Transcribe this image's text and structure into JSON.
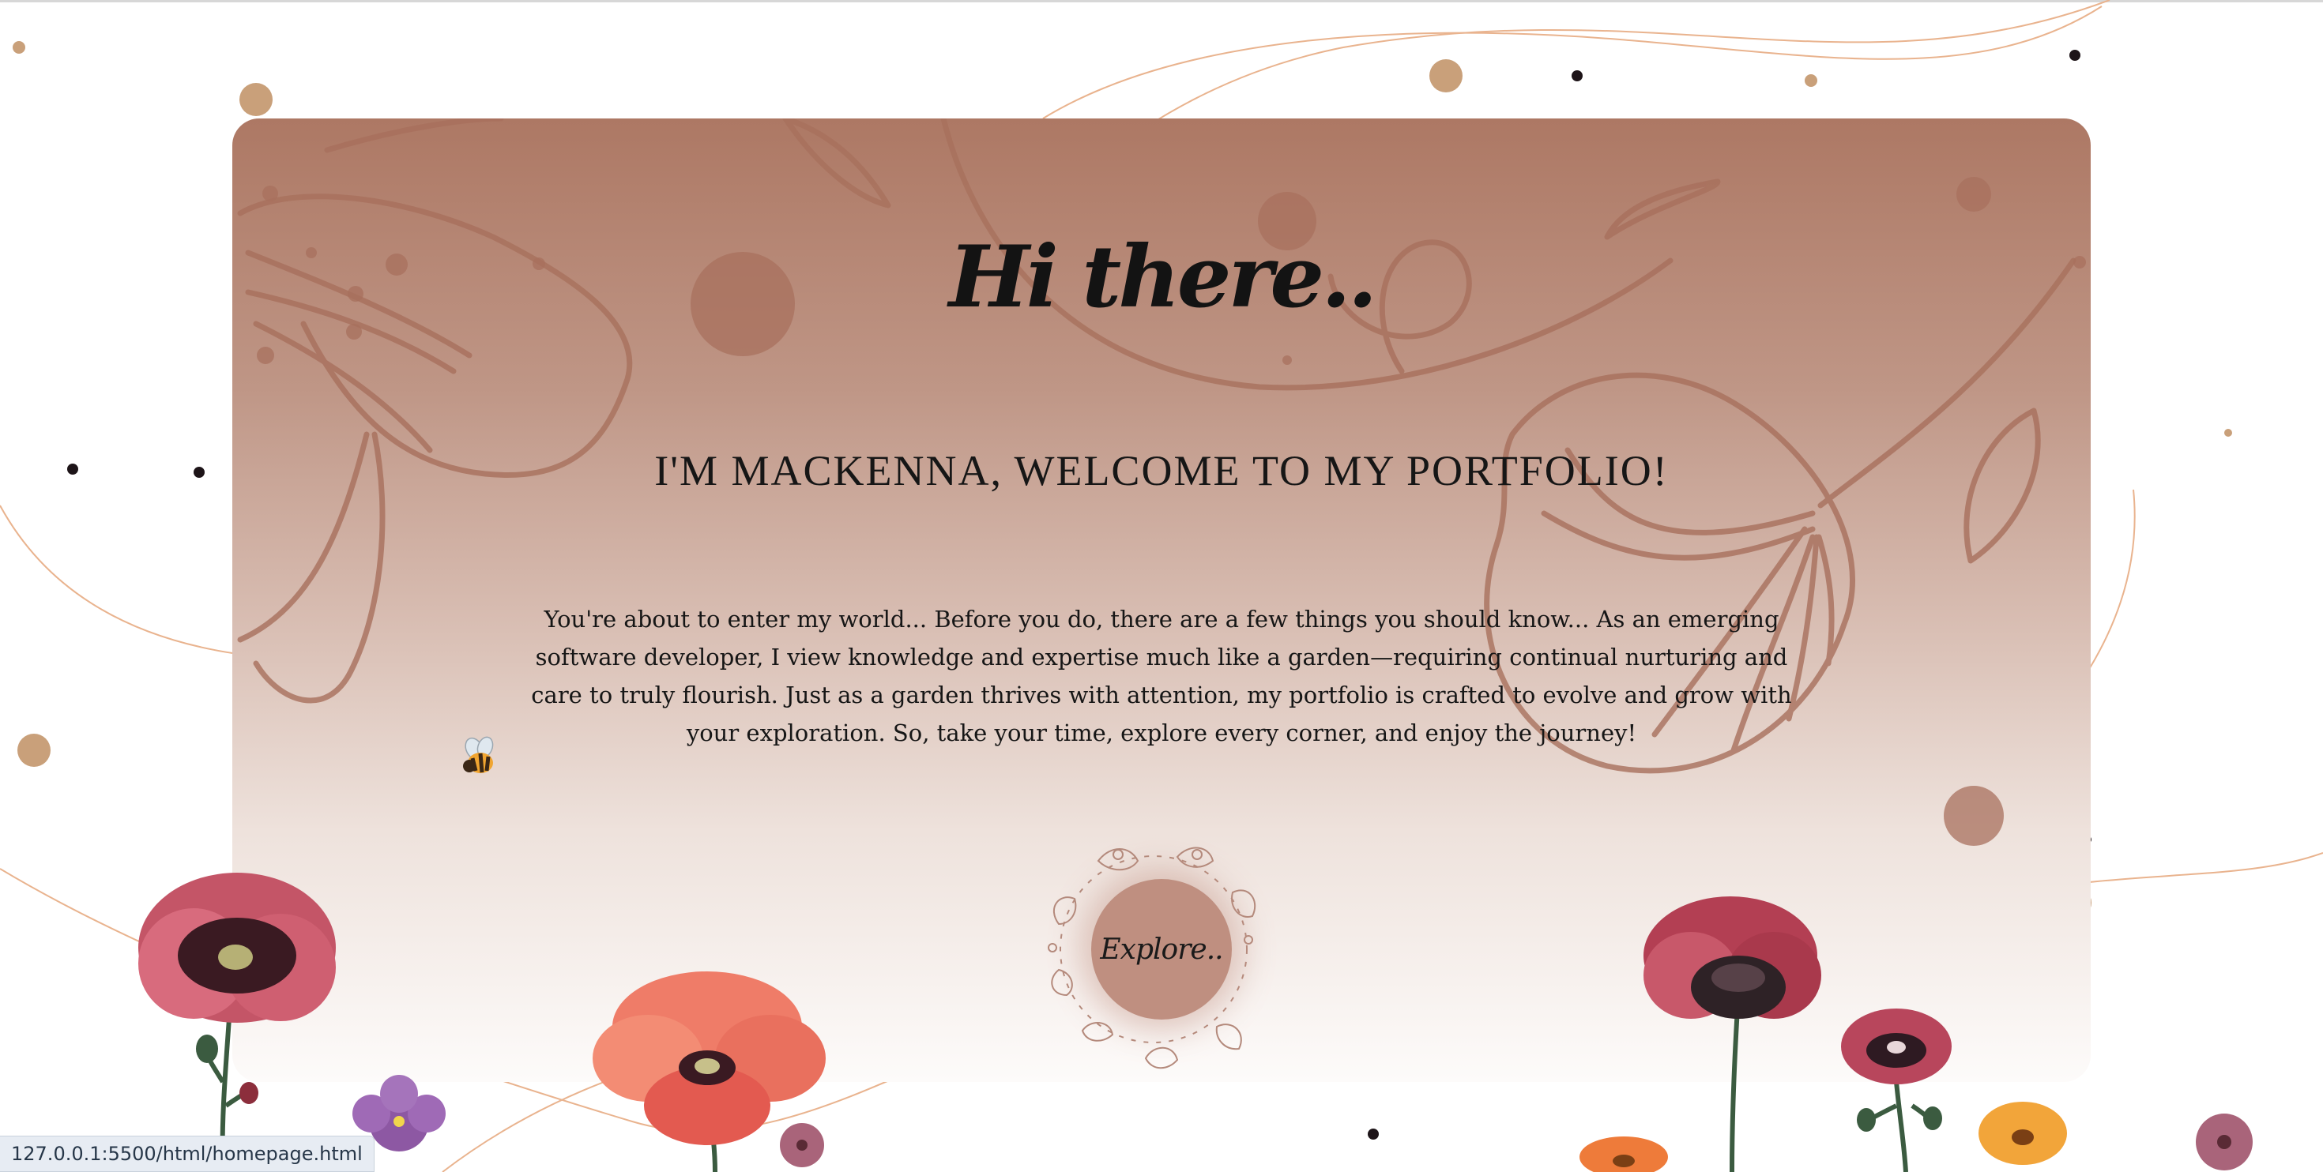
{
  "hero": {
    "greeting": "Hi there..",
    "headline": "I'M MACKENNA, WELCOME TO MY PORTFOLIO!",
    "intro": "You're about to enter my world... Before you do, there are a few things you should know... As an emerging software developer, I view knowledge and expertise much like a garden—requiring continual nurturing and care to truly flourish. Just as a garden thrives with attention, my portfolio is crafted to evolve and grow with your exploration. So, take your time, explore every corner, and enjoy the journey!",
    "explore_label": "Explore.."
  },
  "status_bar": {
    "url": "127.0.0.1:5500/html/homepage.html"
  },
  "colors": {
    "card_top": "#ad7864",
    "card_bottom": "#fdfbfa",
    "floral_line": "#a8705d",
    "accent_line": "#e9b38e",
    "explore_button": "#bf8f80",
    "dot_gold": "#c9a07a",
    "dot_dark": "#1d1418"
  },
  "icons": {
    "bee": "bee-icon",
    "flowers": "poppy-flower-icons"
  }
}
